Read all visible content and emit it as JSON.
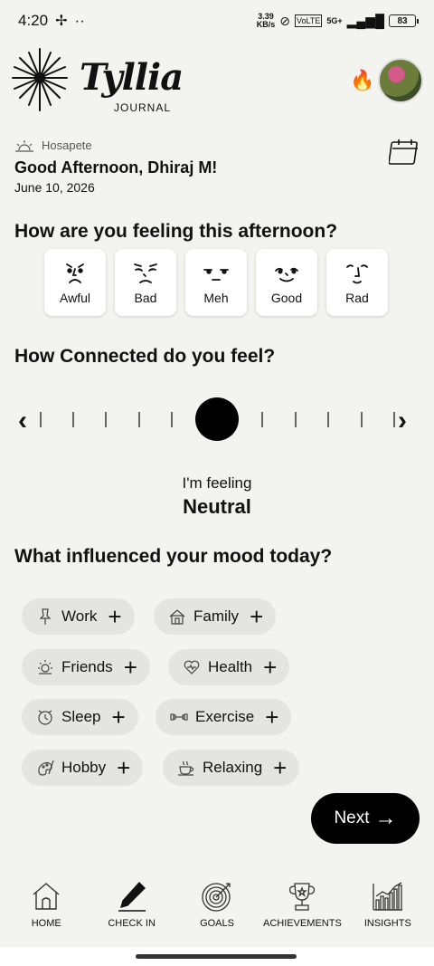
{
  "status_bar": {
    "time": "4:20",
    "dots": "··",
    "net_speed_value": "3.39",
    "net_speed_unit": "KB/s",
    "network": "5G+",
    "battery": "83"
  },
  "header": {
    "brand": "Tyllia",
    "brand_sub": "JOURNAL",
    "streak_icon": "fire-icon"
  },
  "greeting": {
    "location": "Hosapete",
    "text": "Good Afternoon, Dhiraj M!",
    "date": "June 10, 2026"
  },
  "mood_question": "How are you feeling this afternoon?",
  "moods": [
    {
      "label": "Awful"
    },
    {
      "label": "Bad"
    },
    {
      "label": "Meh"
    },
    {
      "label": "Good"
    },
    {
      "label": "Rad"
    }
  ],
  "connection": {
    "question": "How Connected do you feel?",
    "level": 0.5,
    "feeling_label": "I'm feeling",
    "feeling_value": "Neutral"
  },
  "influence_question": "What influenced your mood today?",
  "influences": [
    {
      "label": "Work",
      "icon": "pin-icon"
    },
    {
      "label": "Family",
      "icon": "house-icon"
    },
    {
      "label": "Friends",
      "icon": "sun-icon"
    },
    {
      "label": "Health",
      "icon": "heart-icon"
    },
    {
      "label": "Sleep",
      "icon": "alarm-icon"
    },
    {
      "label": "Exercise",
      "icon": "dumbbell-icon"
    },
    {
      "label": "Hobby",
      "icon": "paint-icon"
    },
    {
      "label": "Relaxing",
      "icon": "cup-icon"
    }
  ],
  "next_button": "Next",
  "nav": [
    {
      "label": "HOME",
      "icon": "home-icon"
    },
    {
      "label": "CHECK IN",
      "icon": "pencil-icon"
    },
    {
      "label": "GOALS",
      "icon": "target-icon"
    },
    {
      "label": "ACHIEVEMENTS",
      "icon": "trophy-icon"
    },
    {
      "label": "INSIGHTS",
      "icon": "chart-icon"
    }
  ]
}
